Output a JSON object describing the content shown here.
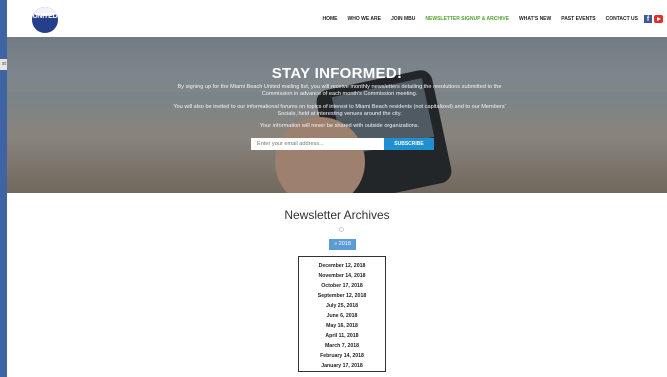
{
  "logo": {
    "text": "UNITED"
  },
  "nav": {
    "items": [
      "HOME",
      "WHO WE ARE",
      "JOIN MBU",
      "NEWSLETTER SIGNUP & ARCHIVE",
      "WHAT'S NEW",
      "PAST EVENTS",
      "CONTACT US"
    ],
    "active_index": 3,
    "active_color": "#51a12d"
  },
  "side_tab": {
    "label": "st"
  },
  "hero": {
    "title": "STAY INFORMED!",
    "p1": "By signing up for the Miami Beach United mailing list, you will receive monthly newsletters detailing the resolutions submitted to the Commission in advance of each month's Commission meeting.",
    "p2": "You will also be invited to our informational forums on topics of interest to Miami Beach residents (not capitalized) and to our Members' Socials, held at interesting venues around the city.",
    "p3": "Your information will never be shared with outside organizations.",
    "email_placeholder": "Enter your email address...",
    "subscribe_label": "SUBSCRIBE",
    "subscribe_color": "#1f8fd0"
  },
  "archives": {
    "title": "Newsletter Archives",
    "year_label": "» 2018",
    "dates": [
      "December 12, 2018",
      "November 14, 2018",
      "October 17, 2018",
      "September 12, 2018",
      "July 25, 2018",
      "June 6, 2018",
      "May 16, 2018",
      "April 11, 2018",
      "March 7, 2018",
      "February 14, 2018",
      "January 17, 2018"
    ]
  }
}
